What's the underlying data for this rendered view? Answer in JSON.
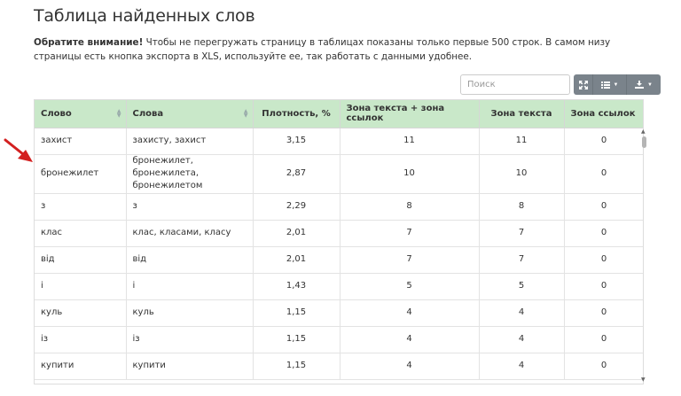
{
  "page": {
    "title": "Таблица найденных слов",
    "notice_bold": "Обратите внимание!",
    "notice_text": " Чтобы не перегружать страницу в таблицах показаны только первые 500 строк. В самом низу страницы есть кнопка экспорта в XLS, используйте ее, так работать с данными удобнее."
  },
  "toolbar": {
    "search_placeholder": "Поиск",
    "fullscreen_icon": "expand-icon",
    "columns_icon": "list-icon",
    "export_icon": "download-icon"
  },
  "table": {
    "headers": [
      "Слово",
      "Слова",
      "Плотность, %",
      "Зона текста + зона ссылок",
      "Зона текста",
      "Зона ссылок"
    ],
    "rows": [
      [
        "захист",
        "захисту, захист",
        "3,15",
        "11",
        "11",
        "0"
      ],
      [
        "бронежилет",
        "бронежилет, бронежилета, бронежилетом",
        "2,87",
        "10",
        "10",
        "0"
      ],
      [
        "з",
        "з",
        "2,29",
        "8",
        "8",
        "0"
      ],
      [
        "клас",
        "клас, класами, класу",
        "2,01",
        "7",
        "7",
        "0"
      ],
      [
        "від",
        "від",
        "2,01",
        "7",
        "7",
        "0"
      ],
      [
        "і",
        "і",
        "1,43",
        "5",
        "5",
        "0"
      ],
      [
        "куль",
        "куль",
        "1,15",
        "4",
        "4",
        "0"
      ],
      [
        "із",
        "із",
        "1,15",
        "4",
        "4",
        "0"
      ],
      [
        "купити",
        "купити",
        "1,15",
        "4",
        "4",
        "0"
      ]
    ]
  },
  "colors": {
    "header_bg": "#c9e8c9",
    "button_bg": "#7a838b",
    "arrow": "#d32020"
  }
}
